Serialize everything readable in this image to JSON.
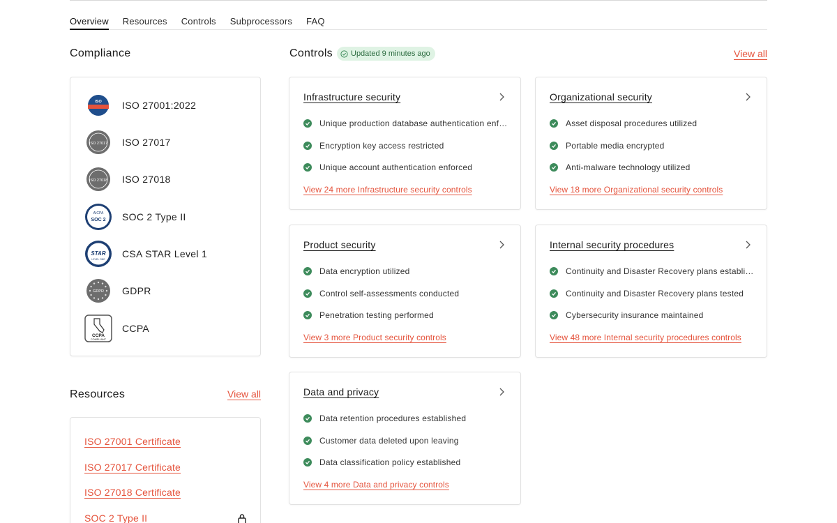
{
  "tabs": [
    {
      "label": "Overview",
      "active": true
    },
    {
      "label": "Resources",
      "active": false
    },
    {
      "label": "Controls",
      "active": false
    },
    {
      "label": "Subprocessors",
      "active": false
    },
    {
      "label": "FAQ",
      "active": false
    }
  ],
  "compliance": {
    "title": "Compliance",
    "items": [
      {
        "name": "ISO 27001:2022",
        "logo_text": "ISO",
        "icon": "iso-27001-badge-icon"
      },
      {
        "name": "ISO 27017",
        "logo_text": "ISO 27017",
        "icon": "iso-27017-badge-icon"
      },
      {
        "name": "ISO 27018",
        "logo_text": "ISO 27018",
        "icon": "iso-27018-badge-icon"
      },
      {
        "name": "SOC 2 Type II",
        "logo_text": "SOC 2",
        "logo_top": "AICPA",
        "icon": "soc2-badge-icon"
      },
      {
        "name": "CSA STAR Level 1",
        "logo_text": "STAR",
        "logo_sub": "LEVEL ONE",
        "icon": "csa-star-badge-icon"
      },
      {
        "name": "GDPR",
        "logo_text": "GDPR",
        "icon": "gdpr-badge-icon"
      },
      {
        "name": "CCPA",
        "logo_text": "CCPA",
        "logo_sub": "COMPLIANT",
        "icon": "ccpa-badge-icon"
      }
    ]
  },
  "resources": {
    "title": "Resources",
    "view_all": "View all",
    "items": [
      {
        "label": "ISO 27001 Certificate",
        "locked": false
      },
      {
        "label": "ISO 27017 Certificate",
        "locked": false
      },
      {
        "label": "ISO 27018 Certificate",
        "locked": false
      },
      {
        "label": "SOC 2 Type II",
        "locked": true
      }
    ]
  },
  "controls": {
    "title": "Controls",
    "updated_badge": "Updated 9 minutes ago",
    "view_all": "View all",
    "cards": [
      {
        "title": "Infrastructure security",
        "items": [
          "Unique production database authentication enforced",
          "Encryption key access restricted",
          "Unique account authentication enforced"
        ],
        "more": "View 24 more Infrastructure security controls"
      },
      {
        "title": "Organizational security",
        "items": [
          "Asset disposal procedures utilized",
          "Portable media encrypted",
          "Anti-malware technology utilized"
        ],
        "more": "View 18 more Organizational security controls"
      },
      {
        "title": "Product security",
        "items": [
          "Data encryption utilized",
          "Control self-assessments conducted",
          "Penetration testing performed"
        ],
        "more": "View 3 more Product security controls"
      },
      {
        "title": "Internal security procedures",
        "items": [
          "Continuity and Disaster Recovery plans established",
          "Continuity and Disaster Recovery plans tested",
          "Cybersecurity insurance maintained"
        ],
        "more": "View 48 more Internal security procedures controls"
      },
      {
        "title": "Data and privacy",
        "items": [
          "Data retention procedures established",
          "Customer data deleted upon leaving",
          "Data classification policy established"
        ],
        "more": "View 4 more Data and privacy controls"
      }
    ]
  },
  "colors": {
    "accent": "#e5533c",
    "check": "#3d8b5b",
    "badge_bg": "#dff3e4"
  }
}
